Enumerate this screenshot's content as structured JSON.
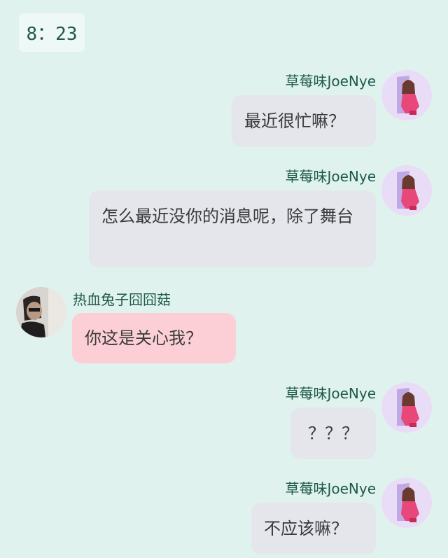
{
  "time": "8：23",
  "messages": [
    {
      "sender": "草莓味JoeNye",
      "text": "最近很忙嘛？"
    },
    {
      "sender": "草莓味JoeNye",
      "text": "怎么最近没你的消息呢，除了舞台"
    },
    {
      "sender": "热血兔子囧囧菇",
      "text": "你这是关心我？"
    },
    {
      "sender": "草莓味JoeNye",
      "text": "？？？"
    },
    {
      "sender": "草莓味JoeNye",
      "text": "不应该嘛？"
    }
  ],
  "colors": {
    "background": "#dff2ee",
    "my_bubble": "#e4e6ec",
    "their_bubble": "#fccfd6",
    "name_text": "#1e5a4a"
  }
}
